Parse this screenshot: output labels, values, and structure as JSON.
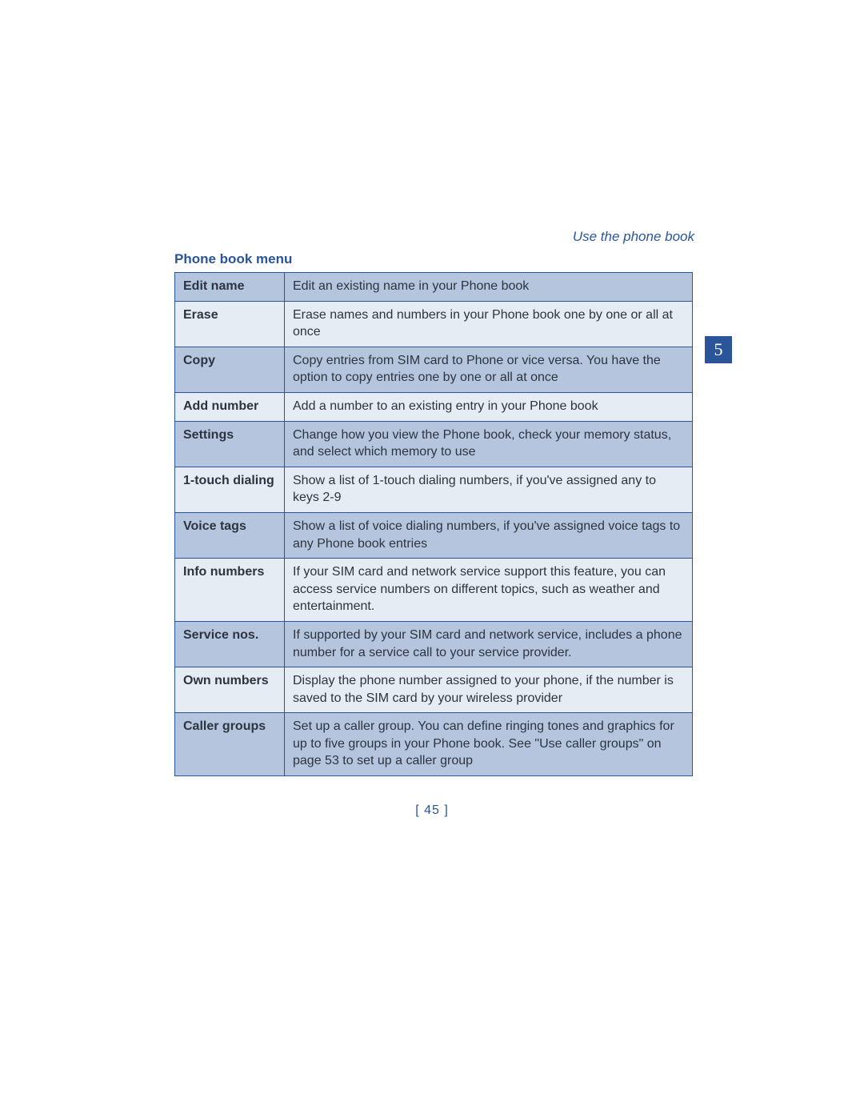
{
  "header": {
    "running_title": "Use the phone book",
    "section_heading": "Phone book menu",
    "chapter_number": "5"
  },
  "table": {
    "rows": [
      {
        "label": "Edit name",
        "desc": "Edit an existing name in your Phone book"
      },
      {
        "label": "Erase",
        "desc": "Erase names and numbers in your Phone book one by one or all at once"
      },
      {
        "label": "Copy",
        "desc": "Copy entries from SIM card to Phone or vice versa. You have the option to copy entries one by one or all at once"
      },
      {
        "label": "Add number",
        "desc": "Add a number to an existing entry in your Phone book"
      },
      {
        "label": "Settings",
        "desc": "Change how you view the Phone book, check your memory status, and select which memory to use"
      },
      {
        "label": "1-touch dialing",
        "desc": "Show a list of 1-touch dialing numbers, if you've assigned any to keys 2-9"
      },
      {
        "label": "Voice tags",
        "desc": "Show a list of voice dialing numbers, if you've assigned voice tags to any Phone book entries"
      },
      {
        "label": "Info numbers",
        "desc": "If your SIM card and network service support this feature, you can access service numbers on different topics, such as weather and entertainment."
      },
      {
        "label": "Service nos.",
        "desc": "If supported by your SIM card and network service, includes a phone number for a service call to your service provider."
      },
      {
        "label": "Own numbers",
        "desc": "Display the phone number assigned to your phone, if the number is saved to the SIM card by your wireless provider"
      },
      {
        "label": "Caller groups",
        "desc": "Set up a caller group. You can define ringing tones and graphics for up to five groups in your Phone book. See \"Use caller groups\" on page 53 to set up a caller group"
      }
    ]
  },
  "footer": {
    "page_number": "[ 45 ]"
  }
}
